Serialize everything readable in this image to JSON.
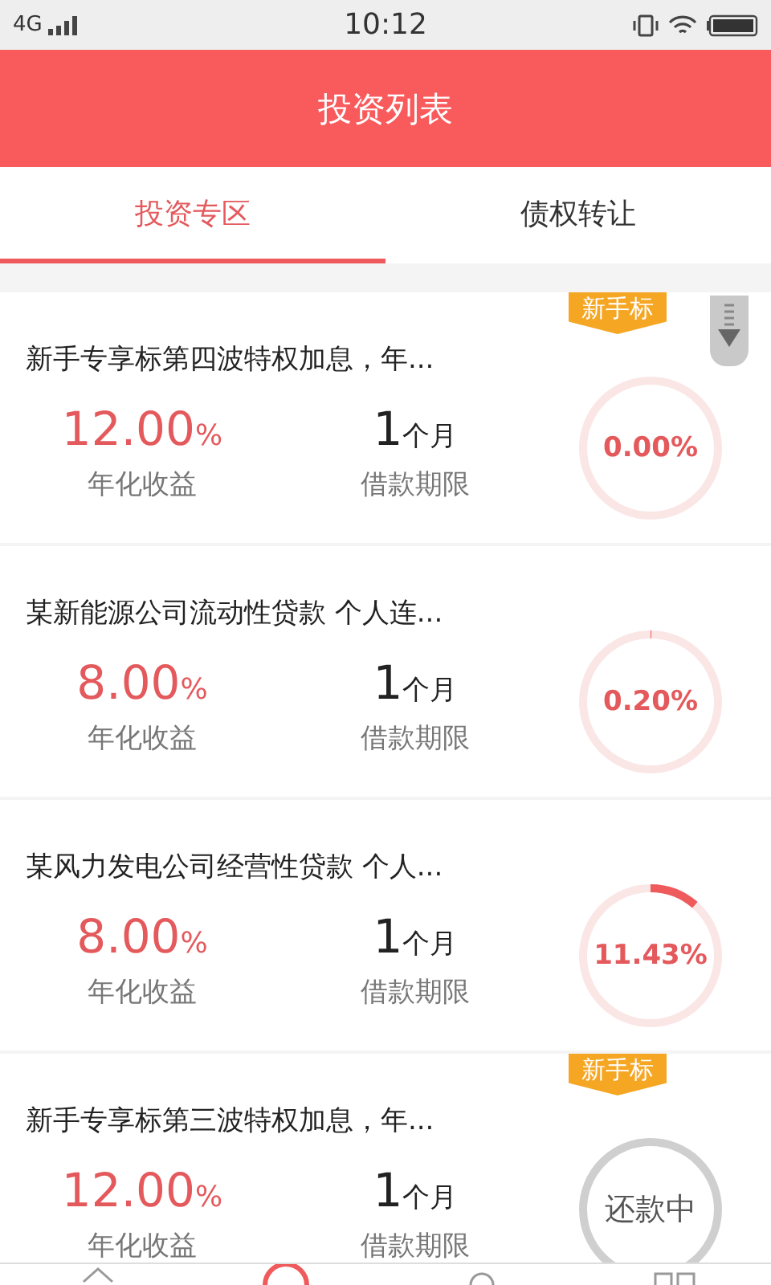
{
  "status_bar": {
    "network": "4G",
    "time": "10:12"
  },
  "header": {
    "title": "投资列表"
  },
  "tabs": [
    {
      "label": "投资专区",
      "selected": true
    },
    {
      "label": "债权转让",
      "selected": false
    }
  ],
  "loans": [
    {
      "title": "新手专享标第四波特权加息，年...",
      "badge": "新手标",
      "rate": "12.00",
      "rate_unit": "%",
      "rate_label": "年化收益",
      "term": "1",
      "term_unit": "个月",
      "term_label": "借款期限",
      "kind": "progress",
      "level": 0,
      "progress_text": "0.00%"
    },
    {
      "title": "某新能源公司流动性贷款 个人连...",
      "rate": "8.00",
      "rate_unit": "%",
      "rate_label": "年化收益",
      "term": "1",
      "term_unit": "个月",
      "term_label": "借款期限",
      "kind": "progress",
      "level": 0.002,
      "progress_text": "0.20%"
    },
    {
      "title": "某风力发电公司经营性贷款 个人...",
      "rate": "8.00",
      "rate_unit": "%",
      "rate_label": "年化收益",
      "term": "1",
      "term_unit": "个月",
      "term_label": "借款期限",
      "kind": "progress",
      "level": 0.1143,
      "progress_text": "11.43%"
    },
    {
      "title": "新手专享标第三波特权加息，年...",
      "badge": "新手标",
      "rate": "12.00",
      "rate_unit": "%",
      "rate_label": "年化收益",
      "term": "1",
      "term_unit": "个月",
      "term_label": "借款期限",
      "kind": "status",
      "status_text": "还款中"
    }
  ]
}
